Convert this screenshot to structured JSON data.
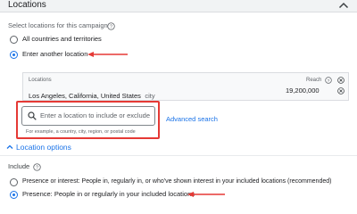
{
  "section": {
    "title": "Locations"
  },
  "select_locations": {
    "label": "Select locations for this campaign",
    "options": [
      {
        "label": "All countries and territories",
        "selected": false
      },
      {
        "label": "Enter another location",
        "selected": true
      }
    ]
  },
  "targeted_locations": {
    "header_locations": "Locations",
    "header_reach": "Reach",
    "items": [
      {
        "name": "Los Angeles, California, United States",
        "type": "city",
        "reach": "19,200,000"
      }
    ]
  },
  "location_search": {
    "placeholder": "Enter a location to include or exclude",
    "hint": "For example, a country, city, region, or postal code",
    "advanced_link": "Advanced search"
  },
  "location_options": {
    "toggle_label": "Location options",
    "include_label": "Include",
    "options": [
      {
        "label": "Presence or interest: People in, regularly in, or who've shown interest in your included locations (recommended)",
        "selected": false
      },
      {
        "label": "Presence: People in or regularly in your included locations",
        "selected": true
      }
    ]
  },
  "colors": {
    "accent": "#1a73e8",
    "annotation": "#e53935"
  },
  "icons": [
    "chevron-up-icon",
    "help-icon",
    "search-icon",
    "remove-icon",
    "annotation-arrow-icon"
  ]
}
